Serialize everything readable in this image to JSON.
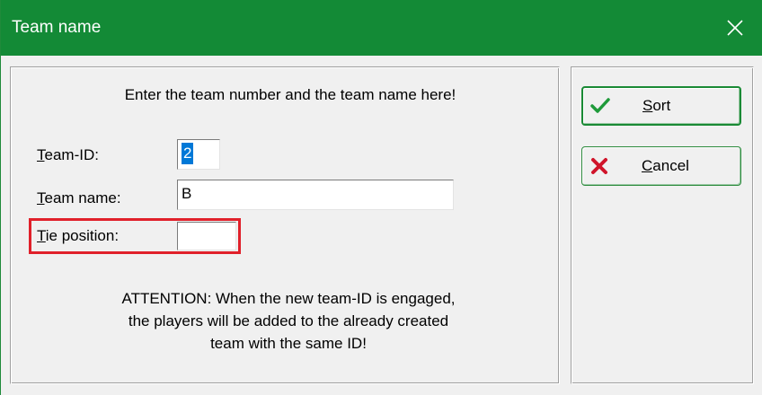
{
  "window": {
    "title": "Team name",
    "close_icon": "close-icon"
  },
  "form": {
    "heading": "Enter the team number and the team name here!",
    "team_id": {
      "label_first": "T",
      "label_rest": "eam-ID:",
      "value": "2"
    },
    "team_name": {
      "label_first": "T",
      "label_rest": "eam name:",
      "value": "B"
    },
    "tie_position": {
      "label_first": "T",
      "label_rest": "ie position:",
      "value": ""
    },
    "attention": [
      "ATTENTION: When the new team-ID is engaged,",
      "the players will be added to the already created",
      "team with the same ID!"
    ]
  },
  "buttons": {
    "sort": {
      "label_first": "S",
      "label_rest": "ort",
      "icon": "checkmark-icon"
    },
    "cancel": {
      "label_first": "C",
      "label_rest": "ancel",
      "icon": "red-x-icon"
    }
  },
  "colors": {
    "titlebar": "#138a36",
    "highlight": "#e0202a",
    "selection": "#0078d7"
  }
}
